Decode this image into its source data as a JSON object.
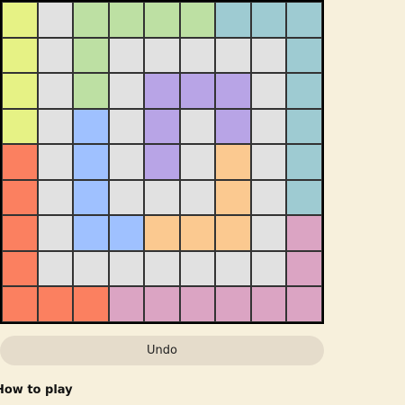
{
  "board": {
    "rows": 9,
    "cols": 9,
    "colors": {
      "Y": "#e6f285",
      "G": "#bde0a3",
      "T": "#9ecbd2",
      "N": "#e1e1e1",
      "B": "#9fc1ff",
      "P": "#b8a4e6",
      "O": "#fbc990",
      "R": "#fb8060",
      "K": "#dba4c3"
    },
    "grid": [
      "YNGGGGTTT",
      "YNGNNNNNT",
      "YNGNPPPNT",
      "YNBNPNPNT",
      "RNBNPNONT",
      "RNBNNNONT",
      "RNBBOOONK",
      "RNNNNNNNK",
      "RRRKKKKKK"
    ]
  },
  "controls": {
    "undo_label": "Undo"
  },
  "footer": {
    "how_to_play": "How to play"
  }
}
